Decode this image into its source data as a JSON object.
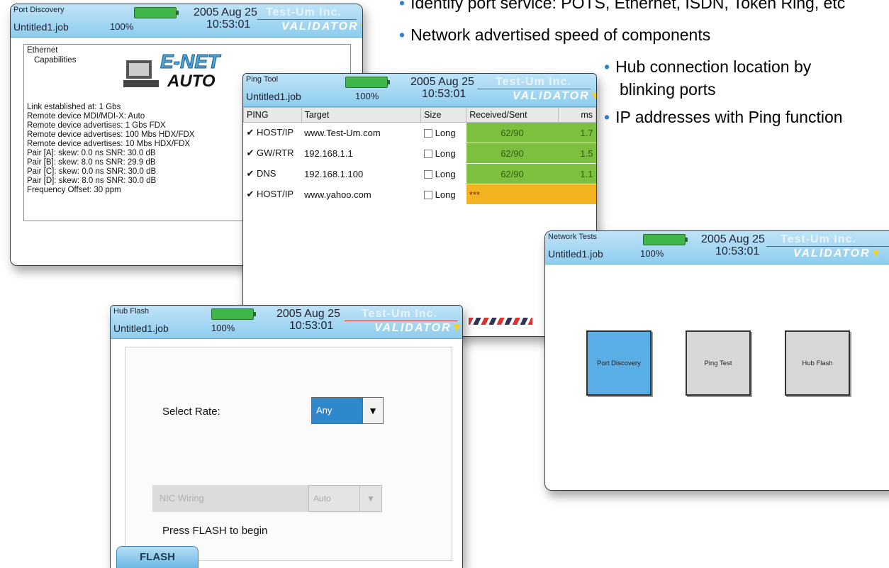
{
  "bullets": [
    "Identify port service: POTS, Ethernet, ISDN, Token Ring, etc",
    "Network advertised speed of components",
    "Hub connection location by",
    "blinking ports",
    "IP addresses with Ping function"
  ],
  "header": {
    "job": "Untitled1.job",
    "battery": "100%",
    "date": "2005 Aug 25",
    "time": "10:53:01",
    "brand": "Test-Um Inc.",
    "product": "VALIDATOR"
  },
  "port_discovery": {
    "title": "Port Discovery",
    "cap_label_1": "Ethernet",
    "cap_label_2": "Capabilities",
    "logo_top": "E-NET",
    "logo_bottom": "AUTO",
    "lines": [
      "Link established at: 1 Gbs",
      "Remote device MDI/MDI-X: Auto",
      "Remote device advertises:  1 Gbs FDX",
      "Remote device advertises: 100 Mbs HDX/FDX",
      "Remote device advertises:  10 Mbs HDX/FDX",
      "Pair [A]:   skew: 0.0 ns     SNR: 30.0 dB",
      "Pair [B]:   skew: 8.0 ns     SNR: 29.9 dB",
      "Pair [C]:   skew: 0.0 ns     SNR: 30.0 dB",
      "Pair [D]:   skew: 8.0 ns     SNR: 30.0 dB",
      "Frequency Offset: 30 ppm"
    ]
  },
  "ping_tool": {
    "title": "Ping Tool",
    "columns": [
      "PING",
      "Target",
      "Size",
      "Received/Sent",
      "ms"
    ],
    "rows": [
      {
        "type": "HOST/IP",
        "target": "www.Test-Um.com",
        "size": "Long",
        "received": "62/90",
        "ms": "1.7"
      },
      {
        "type": "GW/RTR",
        "target": "192.168.1.1",
        "size": "Long",
        "received": "62/90",
        "ms": "1.5"
      },
      {
        "type": "DNS",
        "target": "192.168.1.100",
        "size": "Long",
        "received": "62/90",
        "ms": "1.1"
      },
      {
        "type": "HOST/IP",
        "target": "www.yahoo.com",
        "size": "Long",
        "received": "***",
        "ms": ""
      }
    ]
  },
  "hub_flash": {
    "title": "Hub Flash",
    "select_rate_label": "Select Rate:",
    "rate_value": "Any",
    "nic_label": "NIC Wiring",
    "nic_value": "Auto",
    "press_text": "Press FLASH to begin",
    "flash_button": "FLASH"
  },
  "network_tests": {
    "title": "Network Tests",
    "buttons": [
      "Port Discovery",
      "Ping Test",
      "Hub Flash"
    ]
  },
  "colors": {
    "header_blue": "#8ecdef",
    "battery_green": "#3fb54a",
    "ok_green": "#7dbf3e",
    "pending_orange": "#f3b321",
    "accent_blue": "#2f87cc"
  }
}
